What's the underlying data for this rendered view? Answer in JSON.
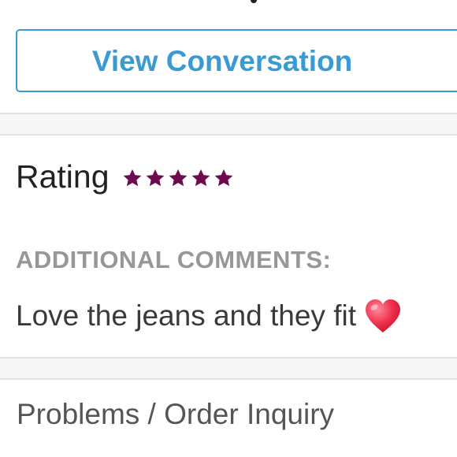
{
  "conversation": {
    "view_button_label": "View Conversation"
  },
  "rating": {
    "label": "Rating",
    "stars_filled": 5,
    "stars_total": 5,
    "star_color": "#6f0a4f",
    "star_icon": "star-icon"
  },
  "comments": {
    "heading": "ADDITIONAL COMMENTS:",
    "text": "Love the jeans and they fit",
    "emoji_icon": "red-heart-icon"
  },
  "footer": {
    "problems_label": "Problems / Order Inquiry"
  },
  "colors": {
    "accent": "#3a9bd4",
    "heading_gray": "#979797",
    "text_dark": "#222222"
  }
}
